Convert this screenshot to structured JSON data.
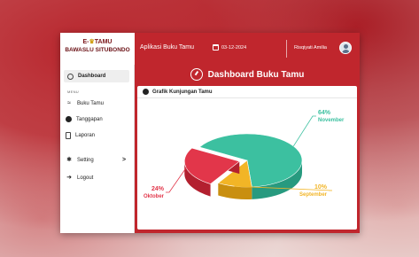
{
  "brand": {
    "line1": "E-",
    "logo_icon": "guestbook-logo-icon",
    "line1_suffix": "TAMU",
    "line2": "BAWASLU SITUBONDO"
  },
  "header": {
    "app_title": "Aplikasi Buku Tamu",
    "date": "03-12-2024",
    "user_name": "Risqiyati Amilia"
  },
  "sidebar": {
    "dashboard_label": "Dashboard",
    "menu_heading": "MENU",
    "items": [
      {
        "label": "Buku Tamu",
        "icon": "guestbook-icon"
      },
      {
        "label": "Tanggapan",
        "icon": "response-icon"
      },
      {
        "label": "Laporan",
        "icon": "report-icon"
      }
    ],
    "setting_label": "Setting",
    "setting_chevron": ">",
    "logout_label": "Logout"
  },
  "main": {
    "page_title": "Dashboard Buku Tamu",
    "card_title": "Grafik Kunjungan Tamu"
  },
  "chart_data": {
    "type": "pie",
    "title": "Grafik Kunjungan Tamu",
    "slices": [
      {
        "label": "November",
        "pct_text": "64%",
        "value": 64,
        "color": "#3cc0a0",
        "side_color": "#279a7f"
      },
      {
        "label": "September",
        "pct_text": "10%",
        "value": 10,
        "color": "#f2b526",
        "side_color": "#c98f10"
      },
      {
        "label": "Oktober",
        "pct_text": "24%",
        "value": 24,
        "color": "#e2364a",
        "side_color": "#b3202f"
      }
    ]
  },
  "colors": {
    "brand_red": "#c0262d",
    "sidebar_bg": "#ffffff"
  }
}
